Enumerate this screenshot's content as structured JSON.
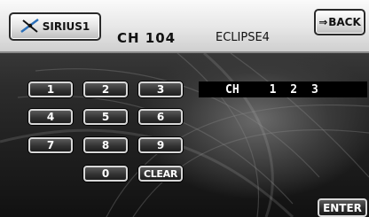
{
  "header": {
    "source_button": {
      "label": "SIRIUS1",
      "icon": "satellite-logo-icon"
    },
    "channel": "CH 104",
    "station_name": "ECLIPSE4",
    "back_button": {
      "label": "BACK",
      "icon": "back-arrow-icon"
    }
  },
  "keypad": {
    "keys": [
      "1",
      "2",
      "3",
      "4",
      "5",
      "6",
      "7",
      "8",
      "9",
      "0"
    ],
    "clear_label": "CLEAR"
  },
  "entry": {
    "prefix": "CH",
    "digits": "123"
  },
  "enter_label": "ENTER"
}
